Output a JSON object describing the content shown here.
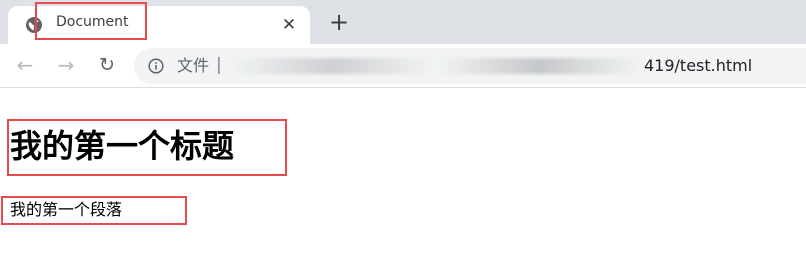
{
  "tab": {
    "title": "Document",
    "close_glyph": "✕",
    "favicon_icon": "globe-icon"
  },
  "new_tab": {
    "glyph": "+"
  },
  "toolbar": {
    "back_glyph": "←",
    "forward_glyph": "→",
    "reload_glyph": "↻",
    "info_icon": "info-icon"
  },
  "address_bar": {
    "label": "文件",
    "separator": "|",
    "url_visible_end": "419/test.html",
    "url_obscured": true
  },
  "page": {
    "heading": "我的第一个标题",
    "paragraph": "我的第一个段落"
  },
  "colors": {
    "highlight_box": "#e8494b",
    "tab_strip_bg": "#dee1e6",
    "omnibox_bg": "#f1f3f4"
  }
}
